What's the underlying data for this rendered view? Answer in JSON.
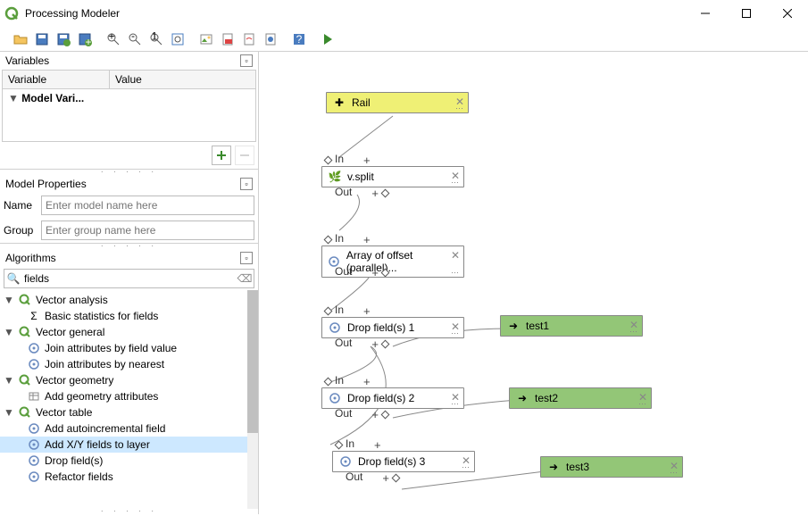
{
  "window": {
    "title": "Processing Modeler"
  },
  "panels": {
    "variables_title": "Variables",
    "var_col1": "Variable",
    "var_col2": "Value",
    "var_row1": "Model Vari...",
    "model_props_title": "Model Properties",
    "name_label": "Name",
    "name_placeholder": "Enter model name here",
    "group_label": "Group",
    "group_placeholder": "Enter group name here",
    "algorithms_title": "Algorithms",
    "search_value": "fields"
  },
  "tree": {
    "cat_analysis": "Vector analysis",
    "item_basicstats": "Basic statistics for fields",
    "cat_general": "Vector general",
    "item_joinfield": "Join attributes by field value",
    "item_joinnear": "Join attributes by nearest",
    "cat_geometry": "Vector geometry",
    "item_addgeom": "Add geometry attributes",
    "cat_table": "Vector table",
    "item_autoinc": "Add autoincremental field",
    "item_addxy": "Add X/Y fields to layer",
    "item_dropfields": "Drop field(s)",
    "item_refactor": "Refactor fields"
  },
  "nodes": {
    "rail": "Rail",
    "vsplit": "v.split",
    "array": "Array of offset (parallel)...",
    "drop1": "Drop field(s) 1",
    "drop2": "Drop field(s) 2",
    "drop3": "Drop field(s) 3",
    "test1": "test1",
    "test2": "test2",
    "test3": "test3",
    "in": "In",
    "out": "Out"
  }
}
